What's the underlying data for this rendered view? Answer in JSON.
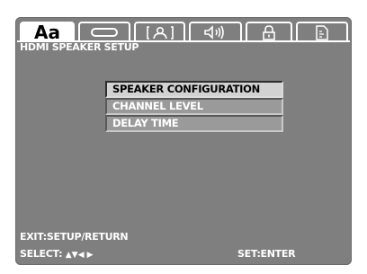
{
  "tabs": [
    {
      "name": "language",
      "text": "Aa",
      "icon": "language-icon",
      "active": true
    },
    {
      "name": "video",
      "text": "",
      "icon": "display-icon",
      "active": false
    },
    {
      "name": "rating",
      "text": "",
      "icon": "person-icon",
      "active": false
    },
    {
      "name": "audio",
      "text": "",
      "icon": "speaker-icon",
      "active": false
    },
    {
      "name": "lock",
      "text": "",
      "icon": "lock-icon",
      "active": false
    },
    {
      "name": "misc",
      "text": "",
      "icon": "sd-card-icon",
      "active": false
    }
  ],
  "page_title": "HDMI SPEAKER SETUP",
  "menu": {
    "items": [
      {
        "label": "SPEAKER CONFIGURATION",
        "selected": true
      },
      {
        "label": "CHANNEL LEVEL",
        "selected": false
      },
      {
        "label": "DELAY TIME",
        "selected": false
      }
    ]
  },
  "footer": {
    "exit_hint": "EXIT:SETUP/RETURN",
    "select_label": "SELECT:",
    "select_arrows": "▲▼◀ ▶",
    "set_hint": "SET:ENTER"
  },
  "colors": {
    "screen_bg": "#7f7f7f",
    "selected_bg": "#d2d2d2",
    "item_bg": "#9a9a9a",
    "text": "#ffffff"
  }
}
